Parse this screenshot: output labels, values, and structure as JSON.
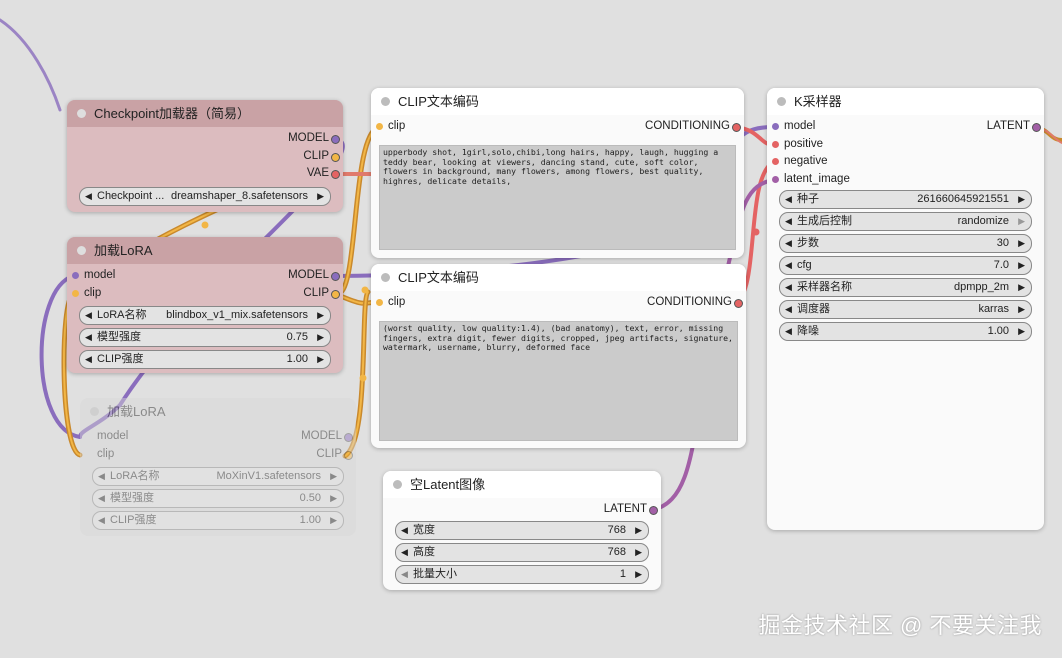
{
  "colors": {
    "canvas": "#e0e0e0",
    "node_pink": "#dcbcbf",
    "node_pink_header": "#c9a2a5",
    "wire_model": "#8a6dbd",
    "wire_clip": "#e8a73a",
    "wire_vae": "#e46363",
    "wire_conditioning": "#e46363",
    "wire_latent": "#a25fa6"
  },
  "checkpoint": {
    "title": "Checkpoint加载器（简易）",
    "outputs": [
      "MODEL",
      "CLIP",
      "VAE"
    ],
    "widget_label": "Checkpoint ...",
    "widget_value": "dreamshaper_8.safetensors"
  },
  "lora": {
    "title": "加载LoRA",
    "inputs": [
      "model",
      "clip"
    ],
    "outputs": [
      "MODEL",
      "CLIP"
    ],
    "widgets": [
      {
        "label": "LoRA名称",
        "value": "blindbox_v1_mix.safetensors"
      },
      {
        "label": "模型强度",
        "value": "0.75"
      },
      {
        "label": "CLIP强度",
        "value": "1.00"
      }
    ]
  },
  "lora2": {
    "title": "加载LoRA",
    "inputs": [
      "model",
      "clip"
    ],
    "outputs": [
      "MODEL",
      "CLIP"
    ],
    "widgets": [
      {
        "label": "LoRA名称",
        "value": "MoXinV1.safetensors"
      },
      {
        "label": "模型强度",
        "value": "0.50"
      },
      {
        "label": "CLIP强度",
        "value": "1.00"
      }
    ]
  },
  "clip_pos": {
    "title": "CLIP文本编码",
    "input": "clip",
    "output": "CONDITIONING",
    "text": "upperbody shot, 1girl,solo,chibi,long hairs, happy, laugh, hugging a teddy bear, looking at viewers, dancing stand, cute, soft color, flowers in background, many flowers, among flowers, best quality, highres, delicate details,"
  },
  "clip_neg": {
    "title": "CLIP文本编码",
    "input": "clip",
    "output": "CONDITIONING",
    "text": "(worst quality, low quality:1.4), (bad anatomy), text, error, missing fingers, extra digit, fewer digits, cropped, jpeg artifacts, signature, watermark, username, blurry, deformed face"
  },
  "latent": {
    "title": "空Latent图像",
    "output": "LATENT",
    "widgets": [
      {
        "label": "宽度",
        "value": "768"
      },
      {
        "label": "高度",
        "value": "768"
      },
      {
        "label": "批量大小",
        "value": "1"
      }
    ]
  },
  "ksampler": {
    "title": "K采样器",
    "inputs": [
      "model",
      "positive",
      "negative",
      "latent_image"
    ],
    "output": "LATENT",
    "widgets": [
      {
        "label": "种子",
        "value": "261660645921551"
      },
      {
        "label": "生成后控制",
        "value": "randomize"
      },
      {
        "label": "步数",
        "value": "30"
      },
      {
        "label": "cfg",
        "value": "7.0"
      },
      {
        "label": "采样器名称",
        "value": "dpmpp_2m"
      },
      {
        "label": "调度器",
        "value": "karras"
      },
      {
        "label": "降噪",
        "value": "1.00"
      }
    ]
  },
  "watermark": "掘金技术社区 @ 不要关注我"
}
